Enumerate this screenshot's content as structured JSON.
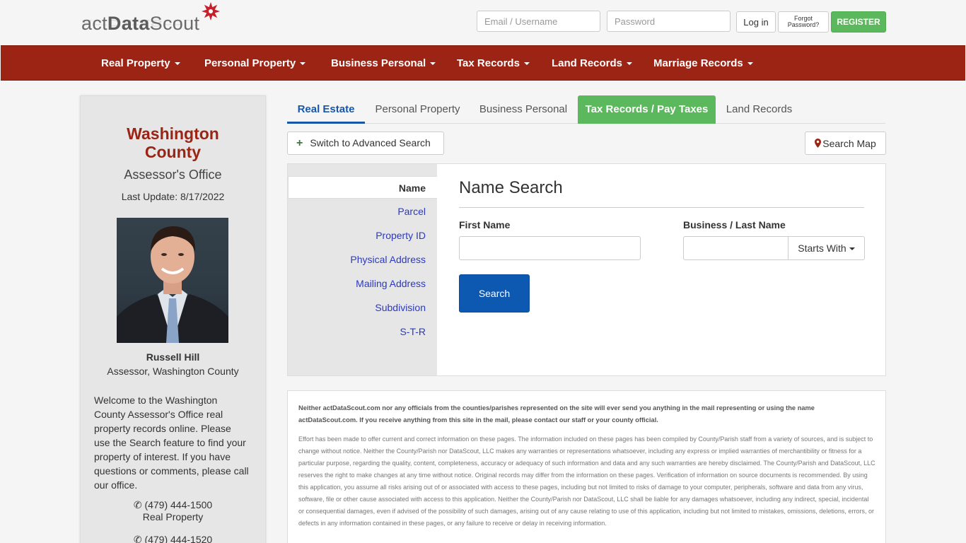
{
  "header": {
    "logo_light": "act",
    "logo_bold": "Data",
    "logo_end": "Scout",
    "email_placeholder": "Email / Username",
    "password_placeholder": "Password",
    "login_label": "Log in",
    "forgot_line1": "Forgot",
    "forgot_line2": "Password?",
    "register_label": "REGISTER"
  },
  "nav": {
    "items": [
      "Real Property",
      "Personal Property",
      "Business Personal",
      "Tax Records",
      "Land Records",
      "Marriage Records"
    ]
  },
  "sidebar": {
    "county_line1": "Washington",
    "county_line2": "County",
    "office": "Assessor's Office",
    "last_update": "Last Update: 8/17/2022",
    "official_name": "Russell Hill",
    "official_title": "Assessor, Washington County",
    "welcome": "Welcome to the Washington County Assessor's Office real property records online. Please use the Search feature to find your property of interest. If you have questions or comments, please call our office.",
    "phones": [
      {
        "number": "(479) 444-1500",
        "label": "Real Property"
      },
      {
        "number": "(479) 444-1520",
        "label": ""
      }
    ]
  },
  "tabs": [
    "Real Estate",
    "Personal Property",
    "Business Personal",
    "Tax Records / Pay Taxes",
    "Land Records"
  ],
  "advanced_search_label": "Switch to Advanced Search",
  "search_map_label": "Search Map",
  "search_nav": [
    "Name",
    "Parcel",
    "Property ID",
    "Physical Address",
    "Mailing Address",
    "Subdivision",
    "S-T-R"
  ],
  "search": {
    "title": "Name Search",
    "first_name_label": "First Name",
    "first_name_value": "",
    "last_name_label": "Business / Last Name",
    "last_name_value": "",
    "starts_with_label": "Starts With",
    "search_button": "Search"
  },
  "disclaimer": {
    "notice": "Neither actDataScout.com nor any officials from the counties/parishes represented on the site will ever send you anything in the mail representing or using the name actDataScout.com. If you receive anything from this site in the mail, please contact our staff or your county official.",
    "text": "Effort has been made to offer current and correct information on these pages. The information included on these pages has been compiled by County/Parish staff from a variety of sources, and is subject to change without notice. Neither the County/Parish nor DataScout, LLC makes any warranties or representations whatsoever, including any express or implied warranties of merchantibility or fitness for a particular purpose, regarding the quality, content, completeness, accuracy or adequacy of such information and data and any such warranties are hereby disclaimed. The County/Parish and DataScout, LLC reserves the right to make changes at any time without notice. Original records may differ from the information on these pages. Verification of information on source documents is recommended. By using this application, you assume all risks arising out of or associated with access to these pages, including but not limited to risks of damage to your computer, peripherals, software and data from any virus, software, file or other cause associated with access to this application. Neither the County/Parish nor DataScout, LLC shall be liable for any damages whatsoever, including any indirect, special, incidental or consequential damages, even if advised of the possibility of such damages, arising out of any cause relating to use of this application, including but not limited to mistakes, omissions, deletions, errors, or defects in any information contained in these pages, or any failure to receive or delay in receiving information."
  },
  "colors": {
    "navbar": "#9c2415",
    "accent_blue": "#0d58b0",
    "green": "#5cb85c",
    "link": "#2a39c4"
  }
}
